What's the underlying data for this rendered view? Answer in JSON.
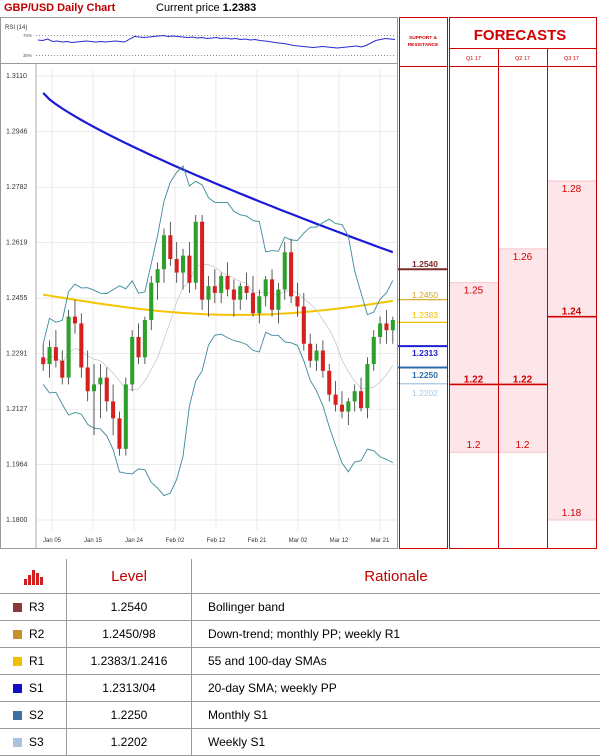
{
  "header": {
    "chart_title": "GBP/USD Daily Chart",
    "price_label": "Current price",
    "price_value": "1.2383"
  },
  "rsi": {
    "label": "RSI (14)",
    "upper": "70%",
    "lower": "30%",
    "values": [
      61,
      60,
      63,
      58,
      59,
      57,
      58,
      56,
      57,
      58,
      59,
      58,
      57,
      58,
      57,
      58,
      59,
      58,
      57,
      63,
      68,
      67,
      66,
      67,
      68,
      69,
      70,
      68,
      69,
      68,
      67,
      66,
      67,
      65,
      66,
      64,
      65,
      66,
      64,
      65,
      63,
      64,
      62,
      63,
      61,
      62,
      60,
      59,
      58,
      56,
      55,
      54,
      52,
      50,
      49,
      48,
      47,
      46,
      47,
      48,
      47,
      46,
      45,
      46,
      47,
      48,
      49,
      47,
      50,
      55,
      60,
      62,
      64,
      63,
      62
    ]
  },
  "support_header": {
    "line1": "SUPPORT &",
    "line2": "RESISTANCE"
  },
  "forecasts": {
    "title": "FORECASTS",
    "columns": [
      {
        "name": "Q1 17",
        "high": 1.25,
        "mid": 1.22,
        "low": 1.2,
        "high_label": "1.25",
        "mid_label": "1.22",
        "low_label": "1.2"
      },
      {
        "name": "Q2 17",
        "high": 1.26,
        "mid": 1.22,
        "low": 1.2,
        "high_label": "1.26",
        "mid_label": "1.22",
        "low_label": "1.2"
      },
      {
        "name": "Q3 17",
        "high": 1.28,
        "mid": 1.24,
        "low": 1.18,
        "high_label": "1.28",
        "mid_label": "1.24",
        "low_label": "1.18"
      }
    ]
  },
  "levels_on_chart": [
    {
      "label": "1.2540",
      "value": 1.254,
      "color": "#7b2b2b",
      "bold": true
    },
    {
      "label": "1.2450",
      "value": 1.245,
      "color": "#d4a02a",
      "bold": false
    },
    {
      "label": "1.2383",
      "value": 1.2383,
      "color": "#f0c000",
      "bold": false
    },
    {
      "label": "1.2313",
      "value": 1.2313,
      "color": "#1f1fcf",
      "bold": true
    },
    {
      "label": "1.2250",
      "value": 1.225,
      "color": "#2e6ea6",
      "bold": true
    },
    {
      "label": "1.2202",
      "value": 1.2202,
      "color": "#a8c6de",
      "bold": false
    }
  ],
  "chart_data": {
    "type": "candlestick",
    "y_ticks": [
      "1.3110",
      "1.2946",
      "1.2782",
      "1.2619",
      "1.2455",
      "1.2291",
      "1.2127",
      "1.1964",
      "1.1800"
    ],
    "ylim": [
      1.18,
      1.311
    ],
    "x_ticks": [
      "Jan 05",
      "Jan 15",
      "Jan 24",
      "Feb 02",
      "Feb 12",
      "Feb 21",
      "Mar 02",
      "Mar 12",
      "Mar 21"
    ],
    "candles": [
      [
        1.228,
        1.232,
        1.224,
        1.226
      ],
      [
        1.226,
        1.233,
        1.222,
        1.231
      ],
      [
        1.231,
        1.236,
        1.225,
        1.227
      ],
      [
        1.227,
        1.23,
        1.22,
        1.222
      ],
      [
        1.222,
        1.242,
        1.22,
        1.24
      ],
      [
        1.24,
        1.245,
        1.235,
        1.238
      ],
      [
        1.238,
        1.241,
        1.222,
        1.225
      ],
      [
        1.225,
        1.23,
        1.215,
        1.218
      ],
      [
        1.218,
        1.226,
        1.205,
        1.22
      ],
      [
        1.22,
        1.226,
        1.21,
        1.222
      ],
      [
        1.222,
        1.225,
        1.212,
        1.215
      ],
      [
        1.215,
        1.22,
        1.205,
        1.21
      ],
      [
        1.21,
        1.212,
        1.199,
        1.201
      ],
      [
        1.201,
        1.222,
        1.199,
        1.22
      ],
      [
        1.22,
        1.236,
        1.218,
        1.234
      ],
      [
        1.234,
        1.238,
        1.226,
        1.228
      ],
      [
        1.228,
        1.24,
        1.226,
        1.239
      ],
      [
        1.239,
        1.252,
        1.236,
        1.25
      ],
      [
        1.25,
        1.256,
        1.245,
        1.254
      ],
      [
        1.254,
        1.266,
        1.25,
        1.264
      ],
      [
        1.264,
        1.268,
        1.255,
        1.257
      ],
      [
        1.257,
        1.262,
        1.25,
        1.253
      ],
      [
        1.253,
        1.26,
        1.248,
        1.258
      ],
      [
        1.258,
        1.262,
        1.247,
        1.25
      ],
      [
        1.25,
        1.27,
        1.248,
        1.268
      ],
      [
        1.268,
        1.27,
        1.242,
        1.245
      ],
      [
        1.245,
        1.252,
        1.24,
        1.249
      ],
      [
        1.249,
        1.254,
        1.244,
        1.247
      ],
      [
        1.247,
        1.253,
        1.244,
        1.252
      ],
      [
        1.252,
        1.256,
        1.246,
        1.248
      ],
      [
        1.248,
        1.251,
        1.24,
        1.245
      ],
      [
        1.245,
        1.25,
        1.242,
        1.249
      ],
      [
        1.249,
        1.253,
        1.245,
        1.247
      ],
      [
        1.247,
        1.252,
        1.24,
        1.241
      ],
      [
        1.241,
        1.248,
        1.238,
        1.246
      ],
      [
        1.246,
        1.252,
        1.243,
        1.251
      ],
      [
        1.251,
        1.254,
        1.24,
        1.242
      ],
      [
        1.242,
        1.25,
        1.238,
        1.248
      ],
      [
        1.248,
        1.262,
        1.245,
        1.259
      ],
      [
        1.259,
        1.263,
        1.244,
        1.246
      ],
      [
        1.246,
        1.25,
        1.24,
        1.243
      ],
      [
        1.243,
        1.247,
        1.23,
        1.232
      ],
      [
        1.232,
        1.235,
        1.225,
        1.227
      ],
      [
        1.227,
        1.232,
        1.224,
        1.23
      ],
      [
        1.23,
        1.233,
        1.222,
        1.224
      ],
      [
        1.224,
        1.226,
        1.215,
        1.217
      ],
      [
        1.217,
        1.221,
        1.212,
        1.214
      ],
      [
        1.214,
        1.218,
        1.21,
        1.212
      ],
      [
        1.212,
        1.216,
        1.208,
        1.215
      ],
      [
        1.215,
        1.22,
        1.212,
        1.218
      ],
      [
        1.218,
        1.222,
        1.212,
        1.213
      ],
      [
        1.213,
        1.228,
        1.21,
        1.226
      ],
      [
        1.226,
        1.236,
        1.224,
        1.234
      ],
      [
        1.234,
        1.24,
        1.232,
        1.238
      ],
      [
        1.238,
        1.242,
        1.232,
        1.236
      ],
      [
        1.236,
        1.24,
        1.232,
        1.239
      ]
    ]
  },
  "table": {
    "headers": {
      "level": "Level",
      "rationale": "Rationale"
    },
    "rows": [
      {
        "name": "R3",
        "level": "1.2540",
        "rationale": "Bollinger band",
        "color": "#8b3a3a"
      },
      {
        "name": "R2",
        "level": "1.2450/98",
        "rationale": "Down-trend; monthly PP; weekly R1",
        "color": "#c98f28"
      },
      {
        "name": "R1",
        "level": "1.2383/1.2416",
        "rationale": "55 and 100-day SMAs",
        "color": "#f3c000"
      },
      {
        "name": "S1",
        "level": "1.2313/04",
        "rationale": "20-day SMA; weekly PP",
        "color": "#1010c8"
      },
      {
        "name": "S2",
        "level": "1.2250",
        "rationale": "Monthly S1",
        "color": "#3f6fa3"
      },
      {
        "name": "S3",
        "level": "1.2202",
        "rationale": "Weekly S1",
        "color": "#a7c3e0"
      }
    ]
  },
  "colors": {
    "accent_red": "#c00000",
    "bull": "#2ca02c",
    "bear": "#d62020"
  }
}
